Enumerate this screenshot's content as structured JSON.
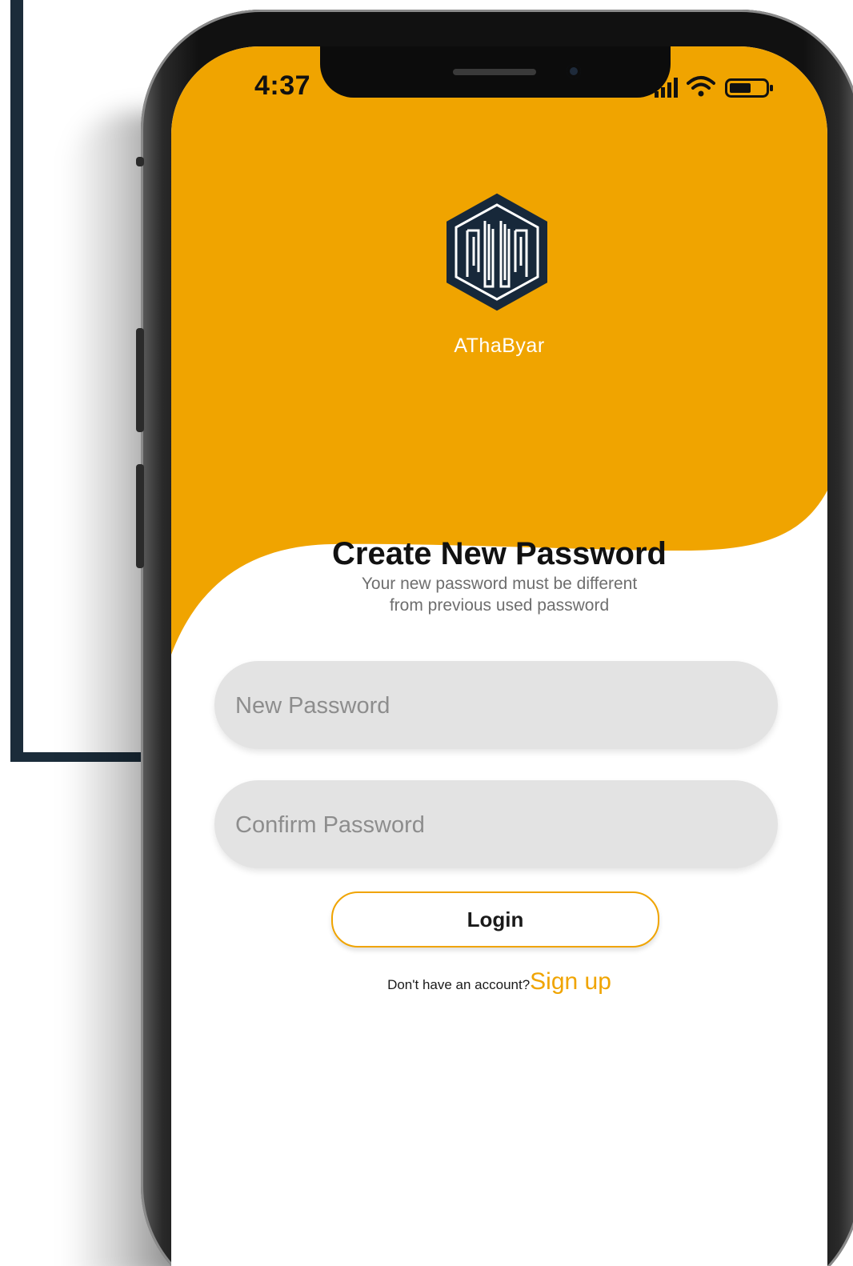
{
  "colors": {
    "accent": "#f0a400",
    "callout": "#1b2c3a",
    "field_bg": "#e3e3e3"
  },
  "status_bar": {
    "time": "4:37",
    "icons": [
      "signal-icon",
      "wifi-icon",
      "battery-icon"
    ]
  },
  "brand": {
    "logo_icon": "hexagon-logo-icon",
    "name": "AThaByar"
  },
  "screen": {
    "title": "Create New Password",
    "subtitle_line1": "Your new password must be different",
    "subtitle_line2": "from previous used password"
  },
  "form": {
    "new_password_placeholder": "New Password",
    "confirm_password_placeholder": "Confirm Password",
    "login_label": "Login"
  },
  "signup": {
    "prompt": "Don't have an account?",
    "link": "Sign up"
  }
}
